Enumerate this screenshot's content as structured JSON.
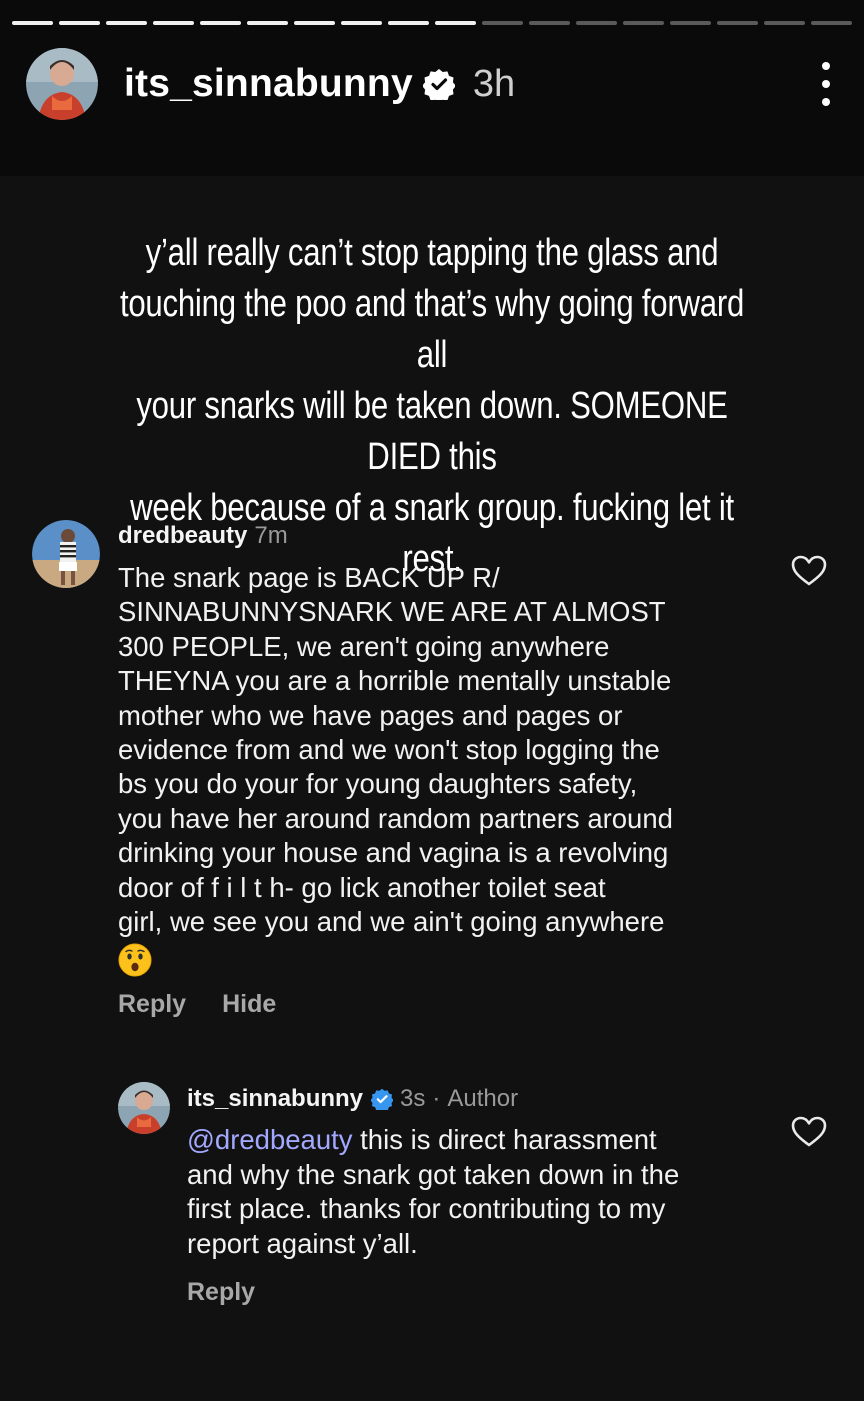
{
  "story": {
    "username": "its_sinnabunny",
    "time": "3h",
    "progress_total": 18,
    "progress_done": 10
  },
  "caption": {
    "lines": [
      "y’all really can’t stop tapping the glass and",
      "touching the poo and that’s why going forward all",
      "your snarks will be taken down. SOMEONE DIED this",
      "week because of a snark group. fucking let it rest."
    ]
  },
  "comment1": {
    "username": "dredbeauty",
    "time": "7m",
    "lines": [
      "The snark page is BACK UP R/",
      "SINNABUNNYSNARK WE ARE AT ALMOST",
      "300 PEOPLE, we aren't going anywhere",
      "THEYNA you are a horrible mentally unstable",
      "mother who we have pages and pages or",
      "evidence from and we won't stop logging the",
      "bs you do your for young daughters safety,",
      "you have her around random partners around",
      "drinking your house and vagina is a revolving",
      "door of f i l t h- go lick another toilet seat",
      "girl, we see you and we ain't going anywhere"
    ],
    "emoji": "hushed-face-emoji",
    "reply_label": "Reply",
    "hide_label": "Hide"
  },
  "comment2": {
    "username": "its_sinnabunny",
    "time": "3s",
    "separator": "·",
    "author_tag": "Author",
    "mention": "@dredbeauty",
    "lines": [
      " this is direct harassment",
      "and why the snark got taken down in the",
      "first place. thanks for contributing to my",
      "report against y’all."
    ],
    "reply_label": "Reply"
  },
  "colors": {
    "background": "#111111",
    "verified_blue": "#3797f0",
    "mention": "#a3a8ff"
  }
}
